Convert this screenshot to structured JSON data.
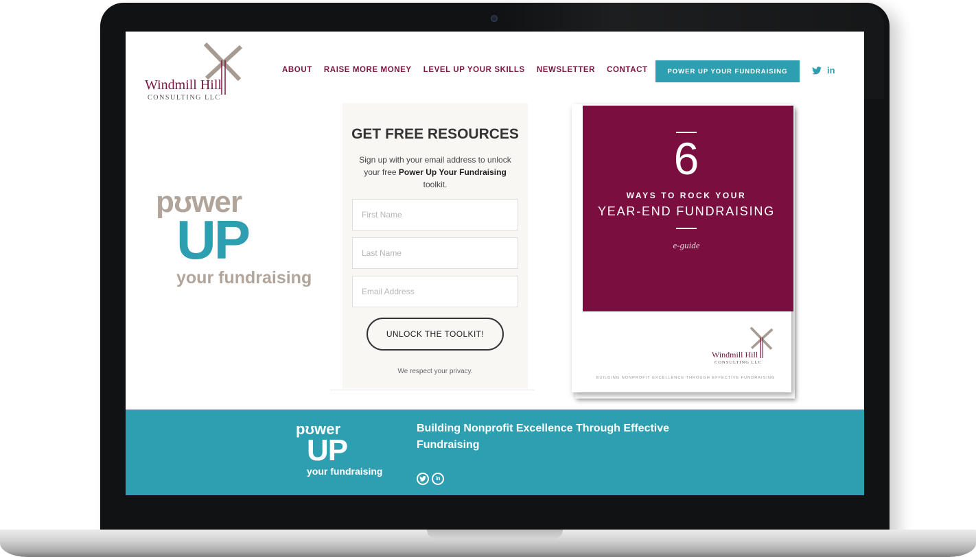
{
  "brand": {
    "name": "Windmill Hill",
    "subtitle": "CONSULTING LLC",
    "color": "#7b1642",
    "accent": "#2e9fb1"
  },
  "nav": {
    "items": [
      {
        "label": "ABOUT"
      },
      {
        "label": "RAISE MORE MONEY"
      },
      {
        "label": "LEVEL UP YOUR SKILLS"
      },
      {
        "label": "NEWSLETTER"
      },
      {
        "label": "CONTACT"
      }
    ],
    "cta": "POWER UP YOUR FUNDRAISING",
    "social": {
      "twitter_icon": "twitter-icon",
      "linkedin_icon": "linkedin-icon",
      "linkedin_text": "in"
    }
  },
  "hero_logo": {
    "word1": "pʊwer",
    "word2": "UP",
    "word3": "your fundraising"
  },
  "form": {
    "title": "GET FREE RESOURCES",
    "desc_before": "Sign up with your email address to unlock your free ",
    "desc_bold": "Power Up Your Fundraising",
    "desc_after": " toolkit.",
    "first_name_placeholder": "First Name",
    "last_name_placeholder": "Last Name",
    "email_placeholder": "Email Address",
    "submit_label": "UNLOCK THE TOOLKIT!",
    "privacy": "We respect your privacy."
  },
  "guide": {
    "number": "6",
    "line1": "WAYS TO ROCK YOUR",
    "line2": "YEAR-END FUNDRAISING",
    "type": "e-guide",
    "logo_name": "Windmill Hill",
    "logo_sub": "CONSULTING LLC",
    "tagline": "BUILDING NONPROFIT EXCELLENCE THROUGH EFFECTIVE FUNDRAISING",
    "cover_color": "#7a0f3f"
  },
  "footer": {
    "logo_word1": "pʊwer",
    "logo_word2": "UP",
    "logo_word3": "your fundraising",
    "tagline": "Building Nonprofit Excellence Through Effective Fundraising",
    "social": {
      "twitter_icon": "twitter-circle-icon",
      "linkedin_icon": "linkedin-circle-icon",
      "linkedin_text": "in"
    }
  }
}
